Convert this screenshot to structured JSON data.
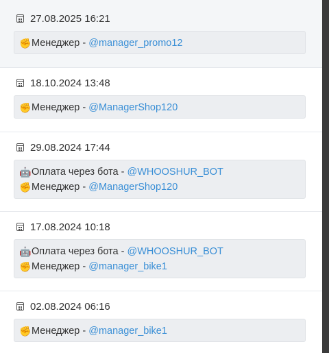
{
  "entries": [
    {
      "date": "27.08.2025 16:21",
      "lines": [
        {
          "emoji": "✊",
          "text": "Менеджер -",
          "handle": "@manager_promo12"
        }
      ]
    },
    {
      "date": "18.10.2024 13:48",
      "lines": [
        {
          "emoji": "✊",
          "text": "Менеджер -",
          "handle": "@ManagerShop120"
        }
      ]
    },
    {
      "date": "29.08.2024 17:44",
      "lines": [
        {
          "emoji": "🤖",
          "text": "Оплата через бота -",
          "handle": "@WHOOSHUR_BOT"
        },
        {
          "emoji": "✊",
          "text": "Менеджер -",
          "handle": "@ManagerShop120"
        }
      ]
    },
    {
      "date": "17.08.2024 10:18",
      "lines": [
        {
          "emoji": "🤖",
          "text": "Оплата через бота -",
          "handle": "@WHOOSHUR_BOT"
        },
        {
          "emoji": "✊",
          "text": "Менеджер -",
          "handle": "@manager_bike1"
        }
      ]
    },
    {
      "date": "02.08.2024 06:16",
      "lines": [
        {
          "emoji": "✊",
          "text": "Менеджер -",
          "handle": "@manager_bike1"
        }
      ]
    }
  ]
}
